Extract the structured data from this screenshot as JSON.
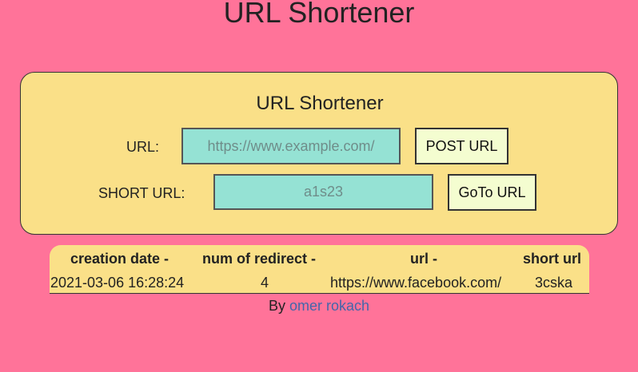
{
  "page": {
    "title": "URL Shortener"
  },
  "form": {
    "title": "URL Shortener",
    "url_label": "URL:",
    "url_placeholder": "https://www.example.com/",
    "url_value": "",
    "post_button": "POST URL",
    "short_label": "SHORT URL:",
    "short_placeholder": "a1s23",
    "short_value": "",
    "goto_button": "GoTo URL"
  },
  "table": {
    "headers": {
      "creation_date": "creation date -",
      "num_redirect": "num of redirect -",
      "url": "url -",
      "short_url": "short url"
    },
    "rows": [
      {
        "creation_date": "2021-03-06 16:28:24",
        "num_redirect": "4",
        "url": "https://www.facebook.com/",
        "short_url": "3cska"
      }
    ]
  },
  "footer": {
    "by_text": "By",
    "author": "omer rokach"
  },
  "colors": {
    "background": "#ff7399",
    "card": "#fae088",
    "input": "#95e2d4",
    "button": "#f4fdd0",
    "link": "#4466aa"
  }
}
